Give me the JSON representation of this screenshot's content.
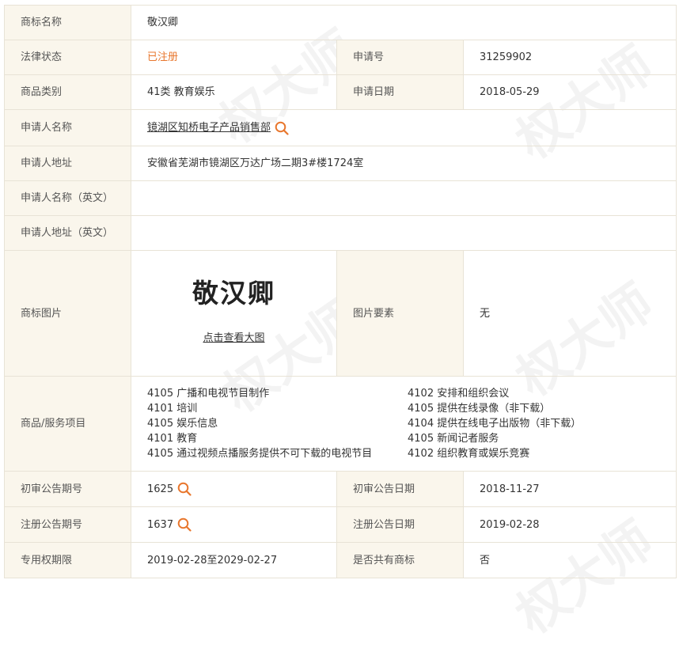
{
  "watermark": "权大师",
  "icons": {
    "search": "search-icon"
  },
  "colors": {
    "accent": "#e8772e",
    "label_bg": "#faf6ec",
    "border": "#e8e3d6"
  },
  "labels": {
    "name": "商标名称",
    "status": "法律状态",
    "app_no": "申请号",
    "class": "商品类别",
    "app_date": "申请日期",
    "applicant": "申请人名称",
    "address": "申请人地址",
    "applicant_en": "申请人名称（英文）",
    "address_en": "申请人地址（英文）",
    "image": "商标图片",
    "elements": "图片要素",
    "services": "商品/服务项目",
    "prelim_no": "初审公告期号",
    "prelim_date": "初审公告日期",
    "reg_no": "注册公告期号",
    "reg_date": "注册公告日期",
    "period": "专用权期限",
    "shared": "是否共有商标"
  },
  "values": {
    "name": "敬汉卿",
    "status": "已注册",
    "app_no": "31259902",
    "class": "41类 教育娱乐",
    "app_date": "2018-05-29",
    "applicant": "镜湖区知桥电子产品销售部",
    "address": "安徽省芜湖市镜湖区万达广场二期3#楼1724室",
    "applicant_en": "",
    "address_en": "",
    "image_text": "敬汉卿",
    "image_link": "点击查看大图",
    "elements": "无",
    "prelim_no": "1625",
    "prelim_date": "2018-11-27",
    "reg_no": "1637",
    "reg_date": "2019-02-28",
    "period": "2019-02-28至2029-02-27",
    "shared": "否"
  },
  "services": [
    "4105 广播和电视节目制作",
    "4102 安排和组织会议",
    "4101 培训",
    "4105 提供在线录像（非下载）",
    "4105 娱乐信息",
    "4104 提供在线电子出版物（非下载）",
    "4101 教育",
    "4105 新闻记者服务",
    "4105 通过视频点播服务提供不可下载的电视节目",
    "4102 组织教育或娱乐竞赛"
  ]
}
